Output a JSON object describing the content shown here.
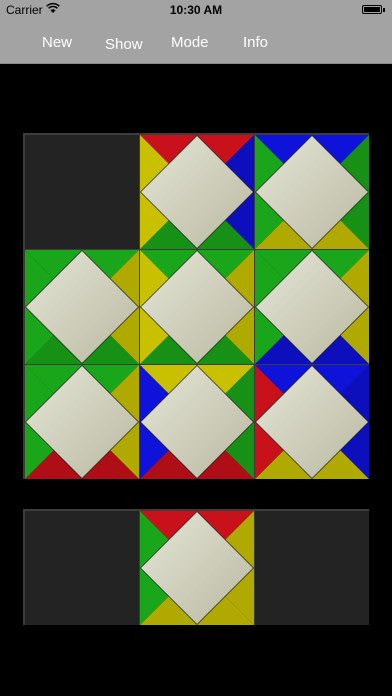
{
  "status_bar": {
    "carrier": "Carrier",
    "time": "10:30 AM",
    "wifi_icon": "wifi-icon",
    "battery_icon": "battery-icon",
    "battery_level": 1.0
  },
  "toolbar": {
    "new_label": "New",
    "show_label": "Show",
    "mode_label": "Mode",
    "info_label": "Info"
  },
  "colors": {
    "red": "#c8111b",
    "blue": "#0f12d8",
    "green": "#1aa61a",
    "yellow": "#c9c100",
    "center": "#d8d8c0",
    "empty_cell": "#232323",
    "board_frame": "#3c3c3c",
    "bar": "#a3a3a3"
  },
  "board": {
    "rows": 3,
    "cols": 3,
    "tiles": [
      null,
      {
        "top": "red",
        "right": "blue",
        "bottom": "green",
        "left": "yellow"
      },
      {
        "top": "blue",
        "right": "green",
        "bottom": "yellow",
        "left": "green"
      },
      {
        "top": "green",
        "right": "yellow",
        "bottom": "green",
        "left": "green"
      },
      {
        "top": "green",
        "right": "yellow",
        "bottom": "green",
        "left": "yellow"
      },
      {
        "top": "green",
        "right": "yellow",
        "bottom": "blue",
        "left": "green"
      },
      {
        "top": "green",
        "right": "yellow",
        "bottom": "red",
        "left": "green"
      },
      {
        "top": "yellow",
        "right": "green",
        "bottom": "red",
        "left": "blue"
      },
      {
        "top": "blue",
        "right": "blue",
        "bottom": "yellow",
        "left": "red"
      }
    ]
  },
  "tray": {
    "slots": [
      null,
      {
        "top": "red",
        "right": "yellow",
        "bottom": "yellow",
        "left": "green"
      },
      null
    ]
  }
}
